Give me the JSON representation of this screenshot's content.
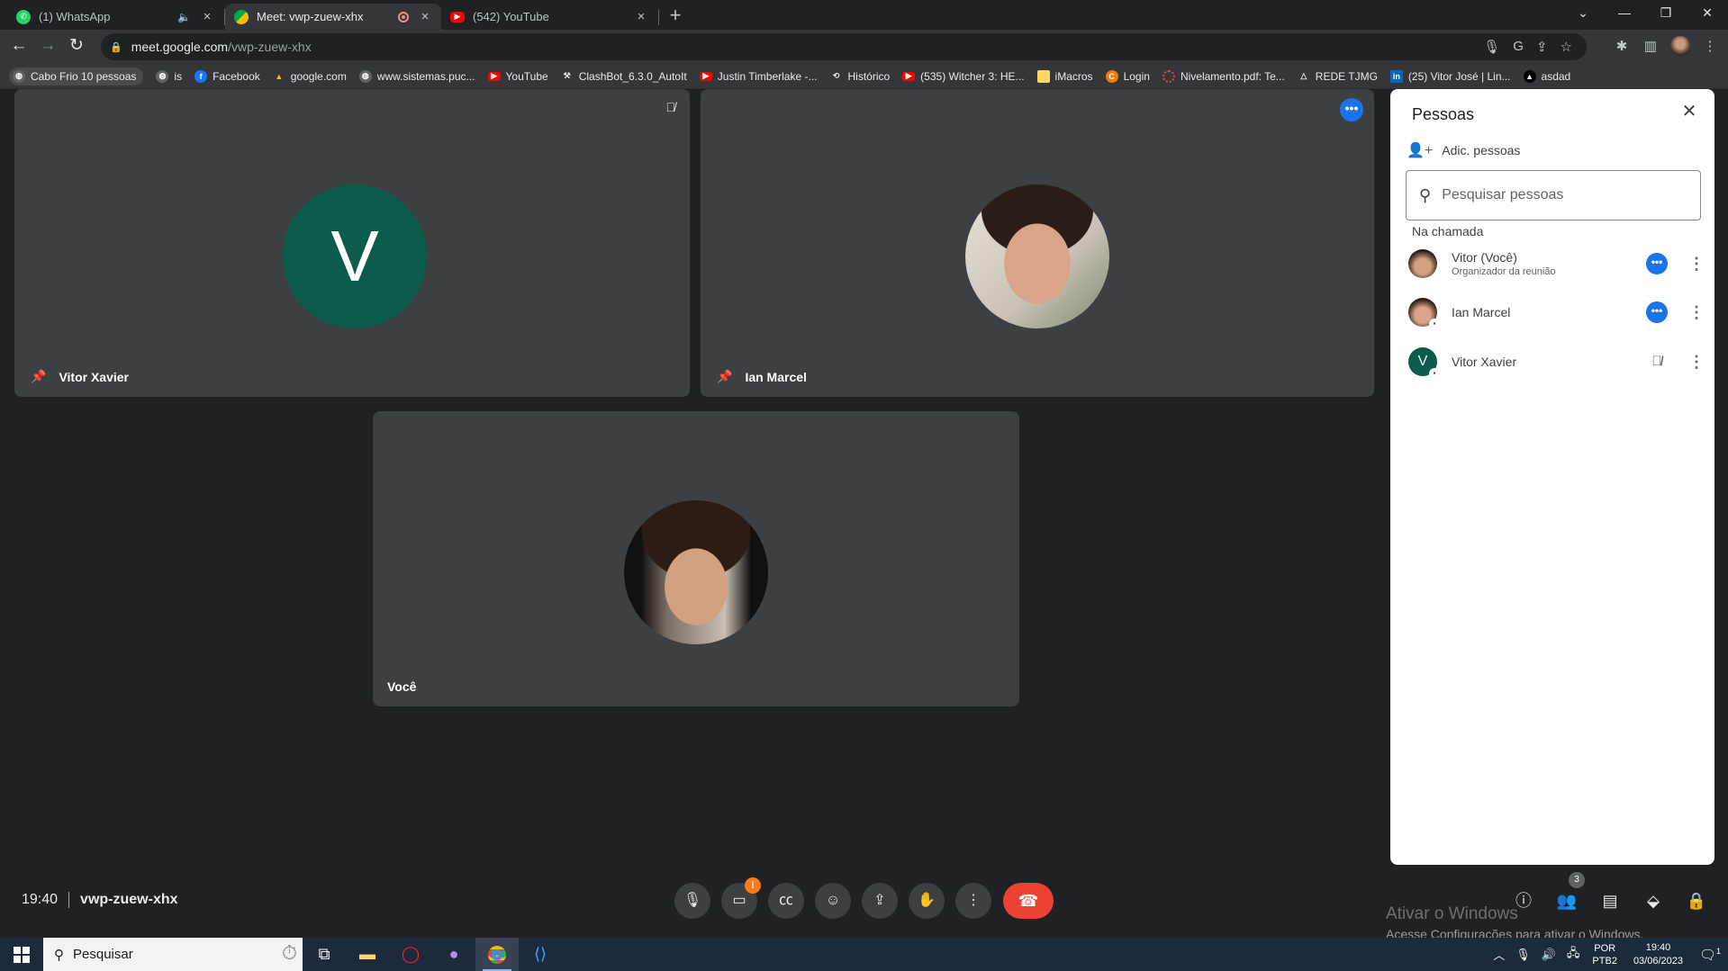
{
  "browser": {
    "tabs": [
      {
        "title": "(1) WhatsApp",
        "favicon": "whatsapp-icon",
        "active": false
      },
      {
        "title": "Meet: vwp-zuew-xhx",
        "favicon": "meet-icon",
        "active": true
      },
      {
        "title": "(542) YouTube",
        "favicon": "youtube-icon",
        "active": false
      }
    ],
    "url_host": "meet.google.com",
    "url_path": "/vwp-zuew-xhx",
    "bookmarks": [
      "Cabo Frio 10 pessoas",
      "is",
      "Facebook",
      "google.com",
      "www.sistemas.puc...",
      "YouTube",
      "ClashBot_6.3.0_AutoIt",
      "Justin Timberlake -...",
      "Histórico",
      "(535) Witcher 3: HE...",
      "iMacros",
      "Login",
      "Nivelamento.pdf: Te...",
      "REDE TJMG",
      "(25) Vitor José | Lin...",
      "asdad"
    ]
  },
  "meet": {
    "tiles": [
      {
        "name": "Vitor Xavier",
        "avatar_letter": "V"
      },
      {
        "name": "Ian Marcel"
      },
      {
        "name": "Você"
      }
    ],
    "people_panel": {
      "title": "Pessoas",
      "add_label": "Adic. pessoas",
      "search_placeholder": "Pesquisar pessoas",
      "section_label": "Na chamada",
      "participants": [
        {
          "name": "Vitor (Você)",
          "subtitle": "Organizador da reunião"
        },
        {
          "name": "Ian Marcel",
          "subtitle": ""
        },
        {
          "name": "Vitor Xavier",
          "subtitle": "",
          "avatar_letter": "V"
        }
      ]
    },
    "bottom": {
      "time": "19:40",
      "meeting_code": "vwp-zuew-xhx",
      "camera_alert": "!",
      "people_badge": "3"
    },
    "watermark": {
      "line1": "Ativar o Windows",
      "line2": "Acesse Configurações para ativar o Windows."
    }
  },
  "taskbar": {
    "search_placeholder": "Pesquisar",
    "lang_line1": "POR",
    "lang_line2": "PTB2",
    "time": "19:40",
    "date": "03/06/2023",
    "notification_count": "1"
  },
  "colors": {
    "avatar_green": "#0b5c4a",
    "accent_blue": "#1a73e8",
    "hangup_red": "#ea4335",
    "tile_bg": "#3c4043"
  }
}
